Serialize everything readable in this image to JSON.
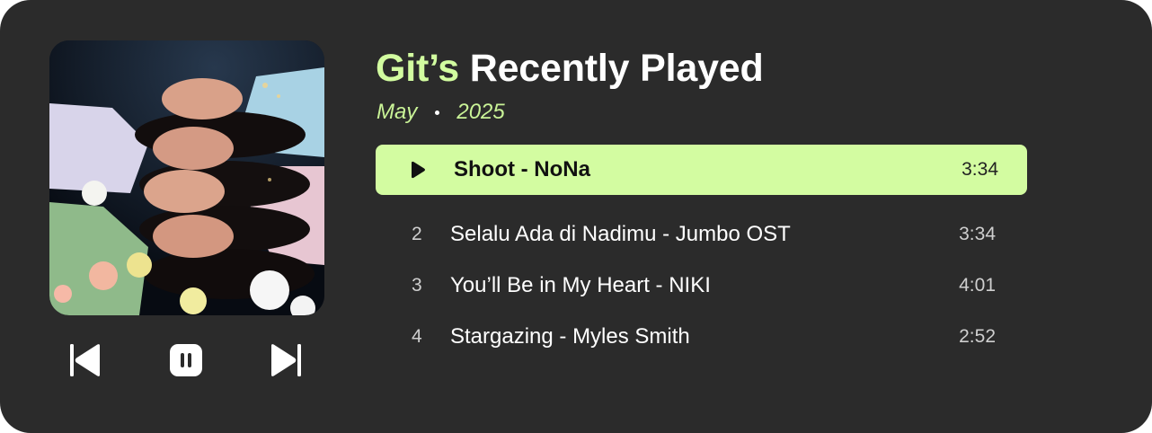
{
  "header": {
    "title_accent": "Git’s",
    "title_rest": "Recently Played",
    "month": "May",
    "year": "2025"
  },
  "cover": {
    "icon": "album-cover-image"
  },
  "controls": {
    "previous_icon": "skip-previous-icon",
    "pause_icon": "pause-icon",
    "next_icon": "skip-next-icon"
  },
  "tracks": [
    {
      "number": "",
      "title": "Shoot - NoNa",
      "duration": "3:34",
      "active": true
    },
    {
      "number": "2",
      "title": "Selalu Ada di Nadimu - Jumbo OST",
      "duration": "3:34",
      "active": false
    },
    {
      "number": "3",
      "title": "You’ll Be in My Heart - NIKI",
      "duration": "4:01",
      "active": false
    },
    {
      "number": "4",
      "title": "Stargazing - Myles Smith",
      "duration": "2:52",
      "active": false
    }
  ],
  "colors": {
    "background": "#2b2b2b",
    "accent": "#d3fca1",
    "text": "#ffffff"
  }
}
